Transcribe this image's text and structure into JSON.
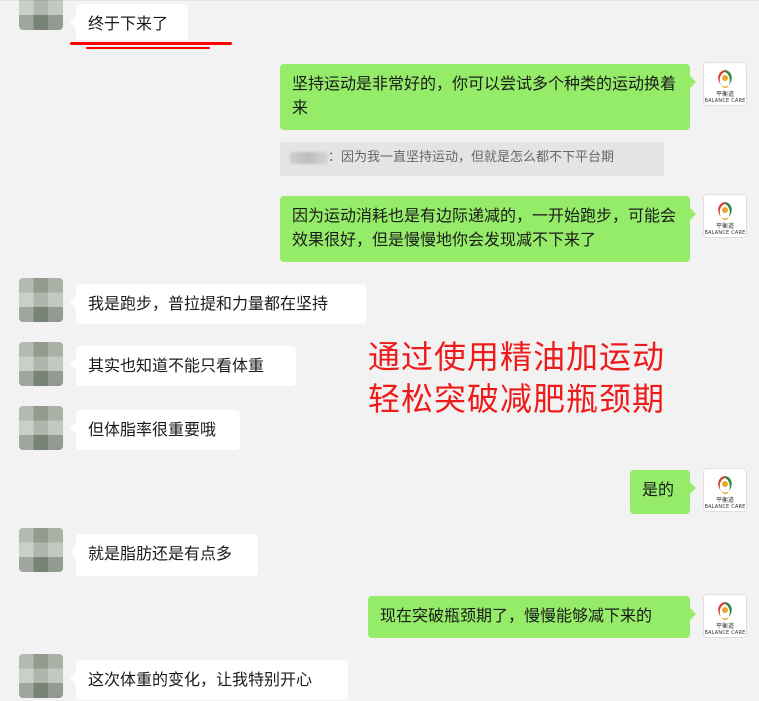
{
  "messages": [
    {
      "side": "left",
      "text": "终于下来了"
    },
    {
      "side": "right",
      "text": "坚持运动是非常好的，你可以尝试多个种类的运动换着来"
    },
    {
      "side": "quote",
      "text": "：因为我一直坚持运动，但就是怎么都不下平台期"
    },
    {
      "side": "right",
      "text": "因为运动消耗也是有边际递减的，一开始跑步，可能会效果很好，但是慢慢地你会发现减不下来了"
    },
    {
      "side": "left",
      "text": "我是跑步，普拉提和力量都在坚持"
    },
    {
      "side": "left",
      "text": "其实也知道不能只看体重"
    },
    {
      "side": "left",
      "text": "但体脂率很重要哦"
    },
    {
      "side": "right",
      "text": "是的"
    },
    {
      "side": "left",
      "text": "就是脂肪还是有点多"
    },
    {
      "side": "right",
      "text": "现在突破瓶颈期了，慢慢能够减下来的"
    },
    {
      "side": "left",
      "text": "这次体重的变化，让我特别开心"
    }
  ],
  "overlay_text": {
    "line1": "通过使用精油加运动",
    "line2": "轻松突破减肥瓶颈期",
    "color": "#ee1b1b"
  },
  "brand": {
    "cn_name": "平衡道",
    "en_name": "BALANCE CARE"
  },
  "colors": {
    "background": "#f2f2f2",
    "right_bubble": "#95ec69",
    "left_bubble": "#ffffff"
  }
}
